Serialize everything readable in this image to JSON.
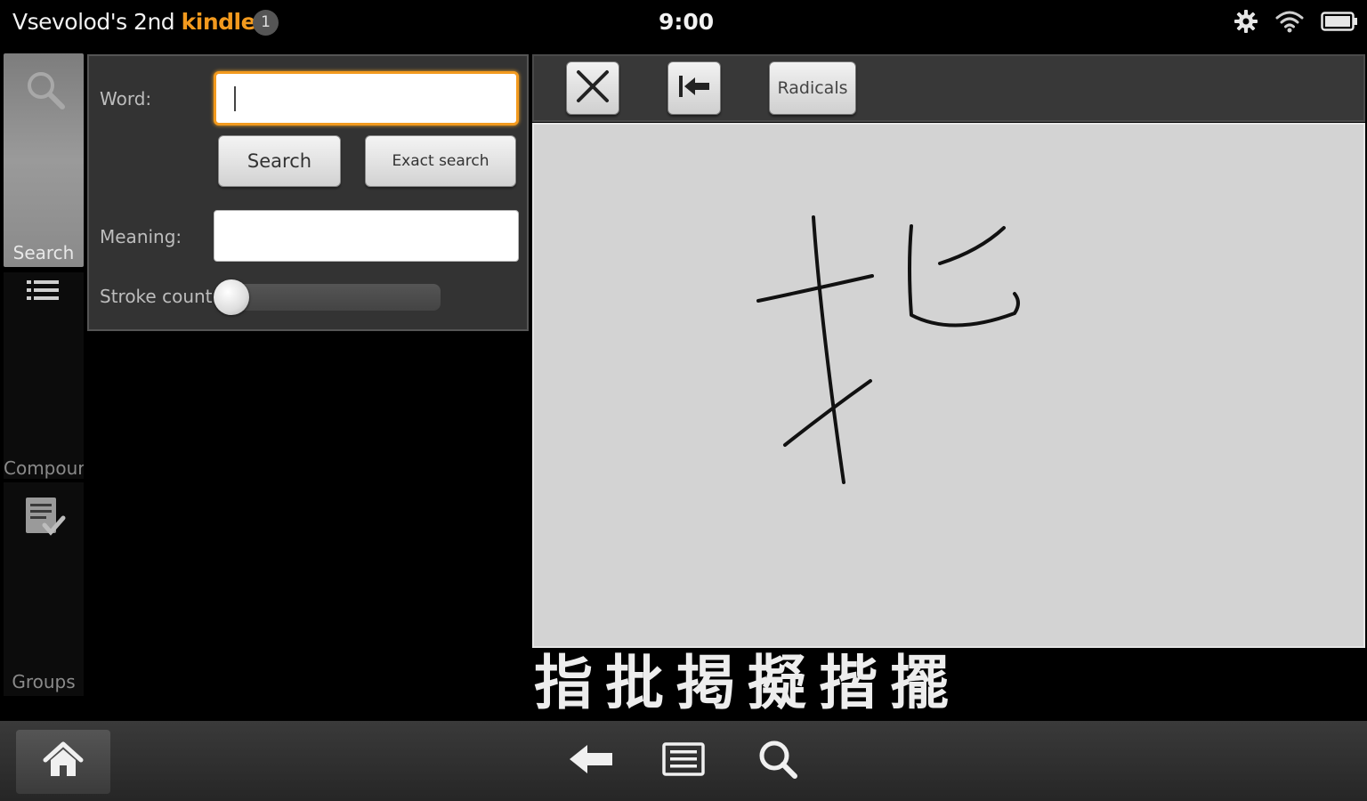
{
  "status_bar": {
    "device_name_prefix": "Vsevolod's 2nd ",
    "device_name_brand": "kindle",
    "notification_count": "1",
    "time": "9:00",
    "brand_color": "#f39a1e",
    "icons": [
      "gear-icon",
      "wifi-icon",
      "battery-icon"
    ]
  },
  "rail": {
    "tabs": [
      {
        "label": "Search",
        "icon": "magnifier-icon",
        "selected": true
      },
      {
        "label": "Compour",
        "icon": "list-icon",
        "selected": false
      },
      {
        "label": "Groups",
        "icon": "checklist-icon",
        "selected": false
      }
    ]
  },
  "form": {
    "word_label": "Word:",
    "word_value": "",
    "search_button": "Search",
    "exact_search_button": "Exact search",
    "meaning_label": "Meaning:",
    "meaning_value": "",
    "stroke_count_label": "Stroke count:",
    "stroke_count_level": 0
  },
  "draw_toolbar": {
    "clear_icon": "close-icon",
    "undo_icon": "undo-stroke-icon",
    "radicals_button": "Radicals"
  },
  "candidates": [
    "指",
    "批",
    "掲",
    "擬",
    "揩",
    "擺"
  ],
  "navbar": {
    "icons": [
      "home-icon",
      "back-icon",
      "menu-icon",
      "search-icon"
    ]
  }
}
